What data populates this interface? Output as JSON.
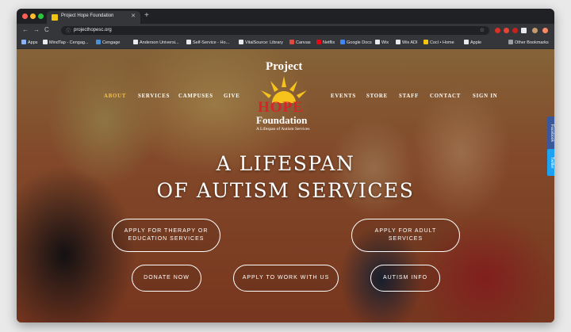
{
  "browser": {
    "tab_title": "Project Hope Foundation",
    "tab_close": "✕",
    "new_tab": "+",
    "url": "projecthopesc.org",
    "back": "←",
    "forward": "→",
    "reload": "C",
    "star": "☆",
    "lock": "ⓘ"
  },
  "bookmarks": [
    {
      "label": "Apps",
      "color": "#8ab4f8"
    },
    {
      "label": "MindTap - Cengag...",
      "color": "#e8eaed"
    },
    {
      "label": "Cengage",
      "color": "#4a90d9"
    },
    {
      "label": "Anderson Universi...",
      "color": "#e8eaed"
    },
    {
      "label": "Self-Service - Ho...",
      "color": "#e8eaed"
    },
    {
      "label": "VitalSource: Library",
      "color": "#e8eaed"
    },
    {
      "label": "Canvas",
      "color": "#e2483d"
    },
    {
      "label": "Netflix",
      "color": "#e50914"
    },
    {
      "label": "Google Docs",
      "color": "#4285f4"
    },
    {
      "label": "Wix",
      "color": "#e8eaed"
    },
    {
      "label": "Wix ADI",
      "color": "#e8eaed"
    },
    {
      "label": "Cocl • Home",
      "color": "#f1c40f"
    },
    {
      "label": "Apple",
      "color": "#e8eaed"
    },
    {
      "label": "»",
      "color": "#35363a"
    },
    {
      "label": "Other Bookmarks",
      "color": "#9aa0a6"
    }
  ],
  "site": {
    "nav": [
      "ABOUT",
      "SERVICES",
      "CAMPUSES",
      "GIVE",
      "EVENTS",
      "STORE",
      "STAFF",
      "CONTACT",
      "SIGN IN"
    ],
    "logo": {
      "line1": "Project",
      "hope": "HOPE",
      "foundation": "Foundation",
      "tagline": "A Lifespan of Autism Services"
    },
    "headline_1": "A LIFESPAN",
    "headline_2": "OF AUTISM SERVICES",
    "buttons": {
      "therapy": "APPLY FOR THERAPY OR EDUCATION SERVICES",
      "adult": "APPLY FOR ADULT SERVICES",
      "donate": "DONATE NOW",
      "work": "APPLY TO WORK WITH US",
      "info": "AUTISM INFO"
    },
    "social": {
      "facebook": "Facebook",
      "twitter": "Twitter"
    },
    "colors": {
      "active_nav": "#f2c14e",
      "hope_red": "#d9232a",
      "sun_yellow": "#f5c31c"
    }
  }
}
